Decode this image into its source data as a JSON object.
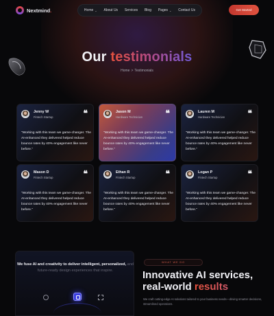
{
  "brand": {
    "name_main": "Nextmind",
    "name_dot": "."
  },
  "nav": {
    "items": [
      {
        "label": "Home",
        "has_dropdown": true
      },
      {
        "label": "About Us",
        "has_dropdown": false
      },
      {
        "label": "Services",
        "has_dropdown": false
      },
      {
        "label": "Blog",
        "has_dropdown": false
      },
      {
        "label": "Pages",
        "has_dropdown": true
      },
      {
        "label": "Contact Us",
        "has_dropdown": false
      }
    ],
    "chevron": "⌄",
    "cta_label": "Get Started"
  },
  "hero": {
    "title_part1": "Our",
    "title_part2": "testimonials",
    "breadcrumb": {
      "home": "Home",
      "separator": ">",
      "current": "Testimonials"
    }
  },
  "testimonials": [
    {
      "name": "Jenny W",
      "role": "Fintech Startup",
      "quote": "“Working with this team we game-changer. The AI-enhanced they delivered helped reduce bounce rates by 40% engagement like never before.”"
    },
    {
      "name": "Jason M",
      "role": "Hardware Technician",
      "quote": "“Working with this team we game-changer. The AI-enhanced they delivered helped reduce bounce rates by 40% engagement like never before.”",
      "highlighted": true
    },
    {
      "name": "Lauren M",
      "role": "Hardware Technician",
      "quote": "“Working with this team we game-changer. The AI-enhanced they delivered helped reduce bounce rates by 40% engagement like never before.”"
    },
    {
      "name": "Mason D",
      "role": "Fintech Startup",
      "quote": "“Working with this team we game-changer. The AI-enhanced they delivered helped reduce bounce rates by 40% engagement like never before.”"
    },
    {
      "name": "Ethan R",
      "role": "Fintech Startup",
      "quote": "“Working with this team we game-changer. The AI-enhanced they delivered helped reduce bounce rates by 40% engagement like never before.”"
    },
    {
      "name": "Logan P",
      "role": "Fintech Startup",
      "quote": "“Working with this team we game-changer. The AI-enhanced they delivered helped reduce bounce rates by 40% engagement like never before.”"
    }
  ],
  "quote_glyph": "❝",
  "feature_panel": {
    "text_bright": "We fuse AI and creativity to deliver intelligent, personalized,",
    "text_dim": " and future-ready design experiences that inspire."
  },
  "services": {
    "badge": "WHAT WE DO",
    "title_part1": "Innovative AI services, real-world",
    "title_part2": "results",
    "description": "We craft cutting-edge AI solutions tailored to your business needs—driving smarter decisions, streamlined operations."
  },
  "colors": {
    "accent": "#e2453d",
    "highlight_card_start": "#c35a3a",
    "highlight_card_end": "#2c3aa6",
    "background": "#08080a"
  }
}
